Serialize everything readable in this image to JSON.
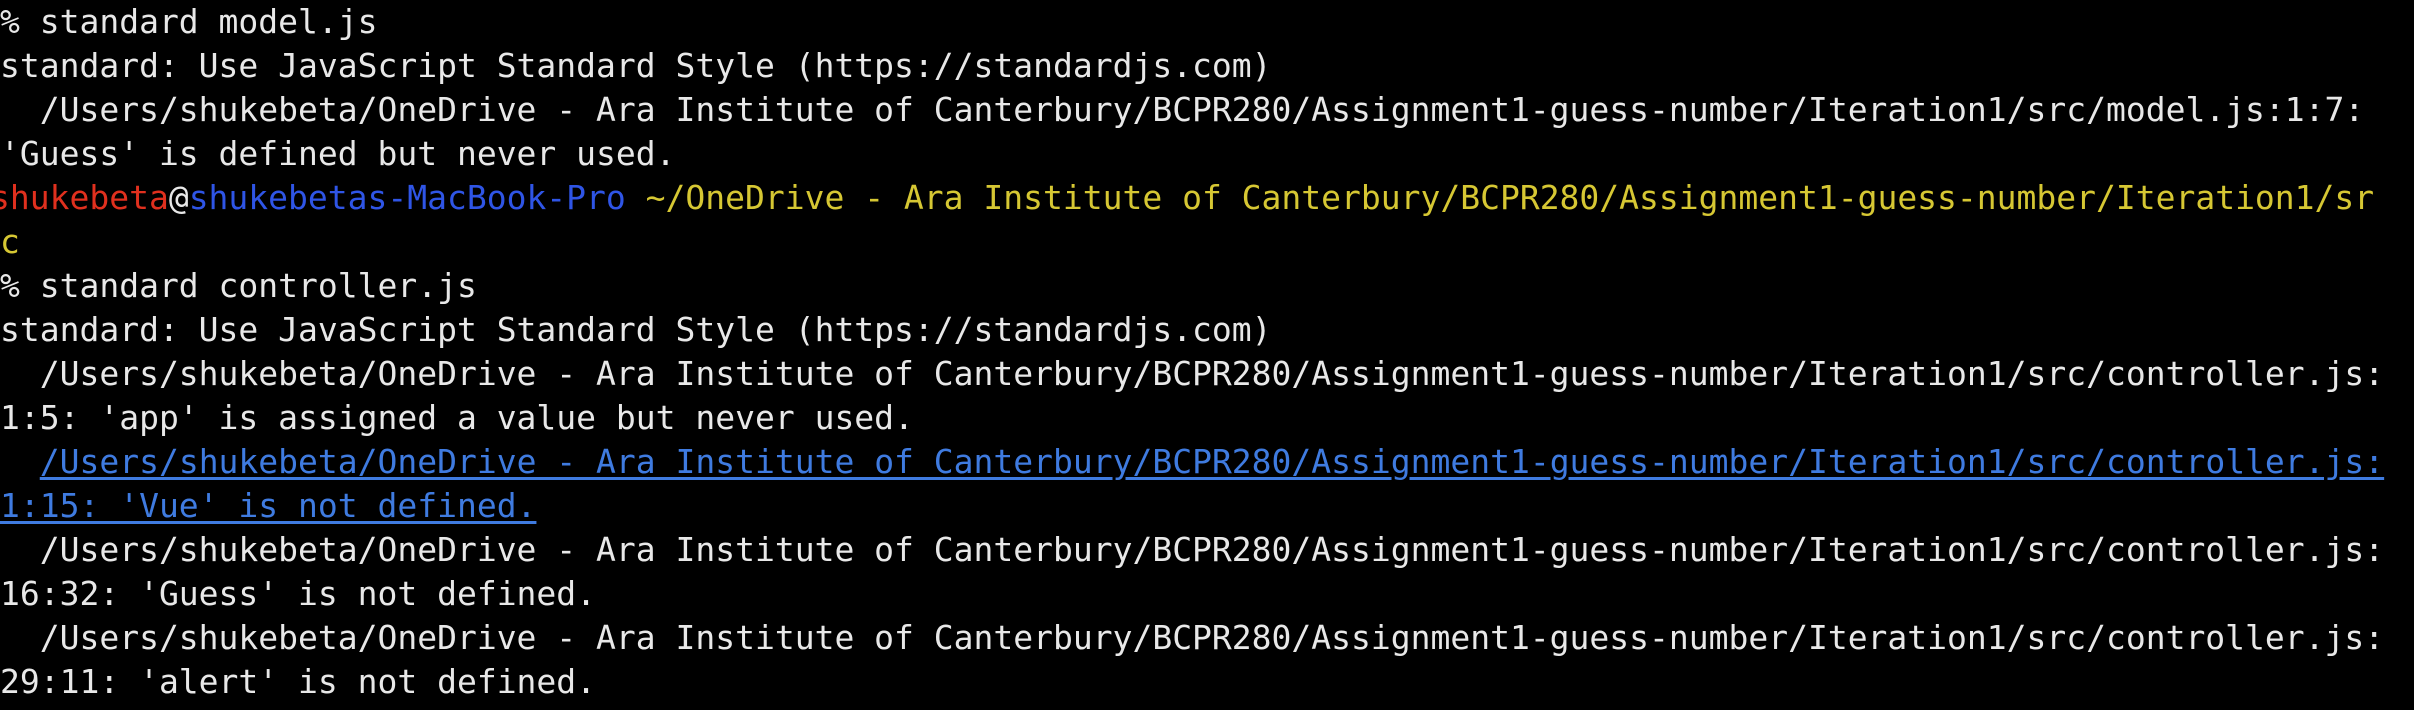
{
  "terminal": {
    "colors": {
      "background": "#000000",
      "text": "#e8e8e8",
      "user": "#e0301e",
      "host": "#2f55e6",
      "path": "#d6c733",
      "link": "#3f7be0"
    },
    "lines": {
      "l0": "% standard model.js",
      "l1": "standard: Use JavaScript Standard Style (https://standardjs.com)",
      "l2": "  /Users/shukebeta/OneDrive - Ara Institute of Canterbury/BCPR280/Assignment1-guess-number/Iteration1/src/model.js:1:7:",
      "l3": "'Guess' is defined but never used.",
      "prompt_user": "shukebeta",
      "prompt_at": "@",
      "prompt_host": "shukebetas-MacBook-Pro",
      "prompt_path": " ~/OneDrive - Ara Institute of Canterbury/BCPR280/Assignment1-guess-number/Iteration1/sr",
      "prompt_path_wrap": "c",
      "l6": "% standard controller.js",
      "l7": "standard: Use JavaScript Standard Style (https://standardjs.com)",
      "l8": "  /Users/shukebeta/OneDrive - Ara Institute of Canterbury/BCPR280/Assignment1-guess-number/Iteration1/src/controller.js:",
      "l9": "1:5: 'app' is assigned a value but never used.",
      "l10_indent": "  ",
      "l10_link": "/Users/shukebeta/OneDrive - Ara Institute of Canterbury/BCPR280/Assignment1-guess-number/Iteration1/src/controller.js:",
      "l11_link": "1:15: 'Vue' is not defined.",
      "l12": "  /Users/shukebeta/OneDrive - Ara Institute of Canterbury/BCPR280/Assignment1-guess-number/Iteration1/src/controller.js:",
      "l13": "16:32: 'Guess' is not defined.",
      "l14": "  /Users/shukebeta/OneDrive - Ara Institute of Canterbury/BCPR280/Assignment1-guess-number/Iteration1/src/controller.js:",
      "l15": "29:11: 'alert' is not defined."
    }
  }
}
